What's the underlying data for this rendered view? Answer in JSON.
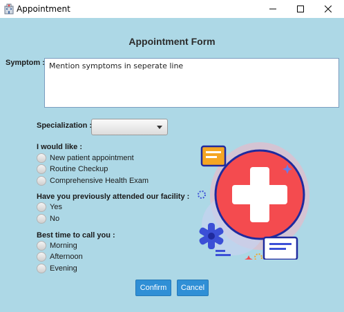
{
  "window": {
    "title": "Appointment",
    "minimize_glyph": "—",
    "close_glyph": "✕"
  },
  "form": {
    "title": "Appointment Form",
    "symptom_label": "Symptom :",
    "symptom_placeholder": "Mention symptoms in seperate line",
    "specialization_label": "Specialization :",
    "specialization_value": "",
    "groups": [
      {
        "label": "I would like :",
        "options": [
          "New patient appointment",
          "Routine Checkup",
          "Comprehensive Health Exam"
        ]
      },
      {
        "label": "Have you previously attended our facility :",
        "options": [
          "Yes",
          "No"
        ]
      },
      {
        "label": "Best time to call you :",
        "options": [
          "Morning",
          "Afternoon",
          "Evening"
        ]
      }
    ],
    "confirm_label": "Confirm",
    "cancel_label": "Cancel"
  },
  "colors": {
    "background": "#add8e6",
    "button": "#2f8fd6",
    "cross_circle": "#f44b4f",
    "accent_blue": "#3b4fd6",
    "accent_orange": "#f5a623"
  },
  "icons": [
    "hospital-icon",
    "minimize-icon",
    "maximize-icon",
    "close-icon",
    "dropdown-arrow-icon",
    "medical-cross-illustration"
  ]
}
